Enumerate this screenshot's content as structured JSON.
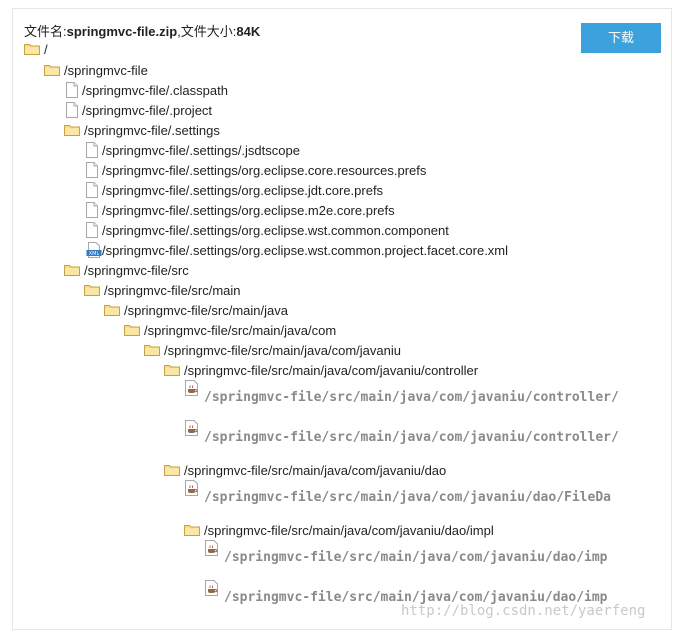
{
  "header": {
    "filename_label": "文件名:",
    "filename": "springmvc-file.zip",
    "size_label": ",文件大小:",
    "size": "84K"
  },
  "download_button": "下载",
  "tree": [
    {
      "type": "folder",
      "label": "/"
    },
    {
      "type": "folder",
      "label": "/springmvc-file"
    },
    {
      "type": "file",
      "label": "/springmvc-file/.classpath"
    },
    {
      "type": "file",
      "label": "/springmvc-file/.project"
    },
    {
      "type": "folder",
      "label": "/springmvc-file/.settings"
    },
    {
      "type": "file",
      "label": "/springmvc-file/.settings/.jsdtscope"
    },
    {
      "type": "file",
      "label": "/springmvc-file/.settings/org.eclipse.core.resources.prefs"
    },
    {
      "type": "file",
      "label": "/springmvc-file/.settings/org.eclipse.jdt.core.prefs"
    },
    {
      "type": "file",
      "label": "/springmvc-file/.settings/org.eclipse.m2e.core.prefs"
    },
    {
      "type": "file",
      "label": "/springmvc-file/.settings/org.eclipse.wst.common.component"
    },
    {
      "type": "xml",
      "label": "/springmvc-file/.settings/org.eclipse.wst.common.project.facet.core.xml"
    },
    {
      "type": "folder",
      "label": "/springmvc-file/src"
    },
    {
      "type": "folder",
      "label": "/springmvc-file/src/main"
    },
    {
      "type": "folder",
      "label": "/springmvc-file/src/main/java"
    },
    {
      "type": "folder",
      "label": "/springmvc-file/src/main/java/com"
    },
    {
      "type": "folder",
      "label": "/springmvc-file/src/main/java/com/javaniu"
    },
    {
      "type": "folder",
      "label": "/springmvc-file/src/main/java/com/javaniu/controller"
    },
    {
      "type": "java",
      "label": "/springmvc-file/src/main/java/com/javaniu/controller/"
    },
    {
      "type": "java",
      "label": "/springmvc-file/src/main/java/com/javaniu/controller/"
    },
    {
      "type": "folder",
      "label": "/springmvc-file/src/main/java/com/javaniu/dao"
    },
    {
      "type": "java",
      "label": "/springmvc-file/src/main/java/com/javaniu/dao/FileDa"
    },
    {
      "type": "folder",
      "label": "/springmvc-file/src/main/java/com/javaniu/dao/impl"
    },
    {
      "type": "java",
      "label": "/springmvc-file/src/main/java/com/javaniu/dao/imp"
    },
    {
      "type": "java",
      "label": "/springmvc-file/src/main/java/com/javaniu/dao/imp"
    }
  ],
  "watermark": "http://blog.csdn.net/yaerfeng"
}
